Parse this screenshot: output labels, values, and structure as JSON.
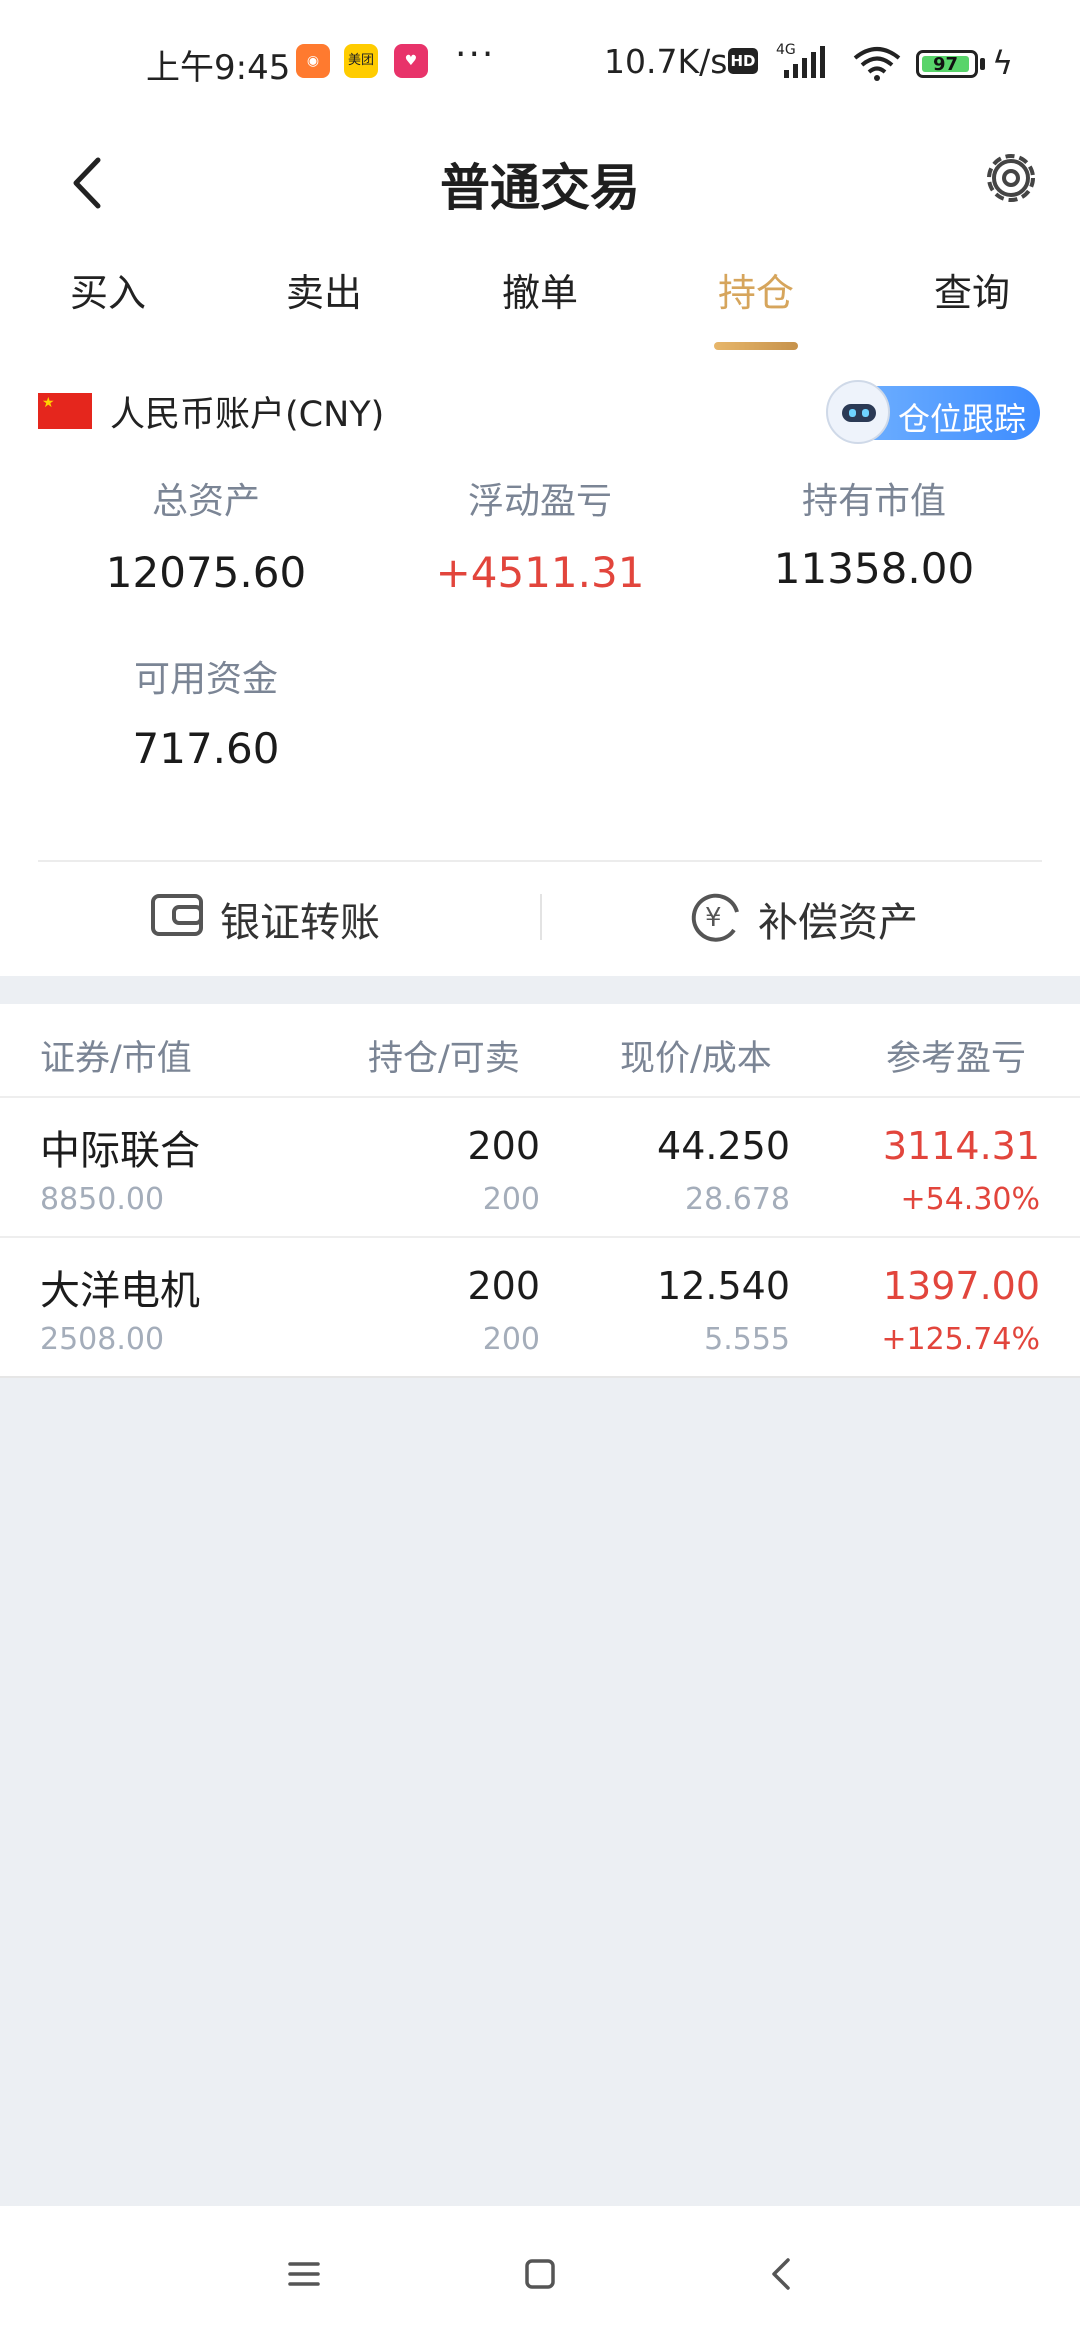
{
  "status": {
    "time": "上午9:45",
    "dots": "···",
    "net_speed": "10.7K/s",
    "hd": "HD",
    "network": "4G",
    "battery": "97",
    "apps": [
      {
        "name": "taobao-icon",
        "color": "#ff7a2f"
      },
      {
        "name": "meituan-icon",
        "color": "#ffcc00",
        "label": "美团"
      },
      {
        "name": "pinduoduo-icon",
        "color": "#e8336a"
      }
    ]
  },
  "header": {
    "title": "普通交易"
  },
  "tabs": [
    {
      "label": "买入"
    },
    {
      "label": "卖出"
    },
    {
      "label": "撤单"
    },
    {
      "label": "持仓",
      "active": true
    },
    {
      "label": "查询"
    }
  ],
  "account": {
    "name": "人民币账户(CNY)",
    "track_label": "仓位跟踪"
  },
  "stats": {
    "total_assets": {
      "label": "总资产",
      "value": "12075.60"
    },
    "floating_pl": {
      "label": "浮动盈亏",
      "value": "+4511.31"
    },
    "market_value": {
      "label": "持有市值",
      "value": "11358.00"
    },
    "available_funds": {
      "label": "可用资金",
      "value": "717.60"
    }
  },
  "actions": {
    "bank_transfer": "银证转账",
    "compensation": "补偿资产"
  },
  "holdings": {
    "columns": [
      "证券/市值",
      "持仓/可卖",
      "现价/成本",
      "参考盈亏"
    ],
    "rows": [
      {
        "name": "中际联合",
        "market_value": "8850.00",
        "position": "200",
        "sellable": "200",
        "price": "44.250",
        "cost": "28.678",
        "pl": "3114.31",
        "pl_pct": "+54.30%"
      },
      {
        "name": "大洋电机",
        "market_value": "2508.00",
        "position": "200",
        "sellable": "200",
        "price": "12.540",
        "cost": "5.555",
        "pl": "1397.00",
        "pl_pct": "+125.74%"
      }
    ]
  },
  "colors": {
    "accent": "#d6a55c",
    "profit": "#e2453c",
    "muted": "#7b8595",
    "background": "#eceff3"
  }
}
